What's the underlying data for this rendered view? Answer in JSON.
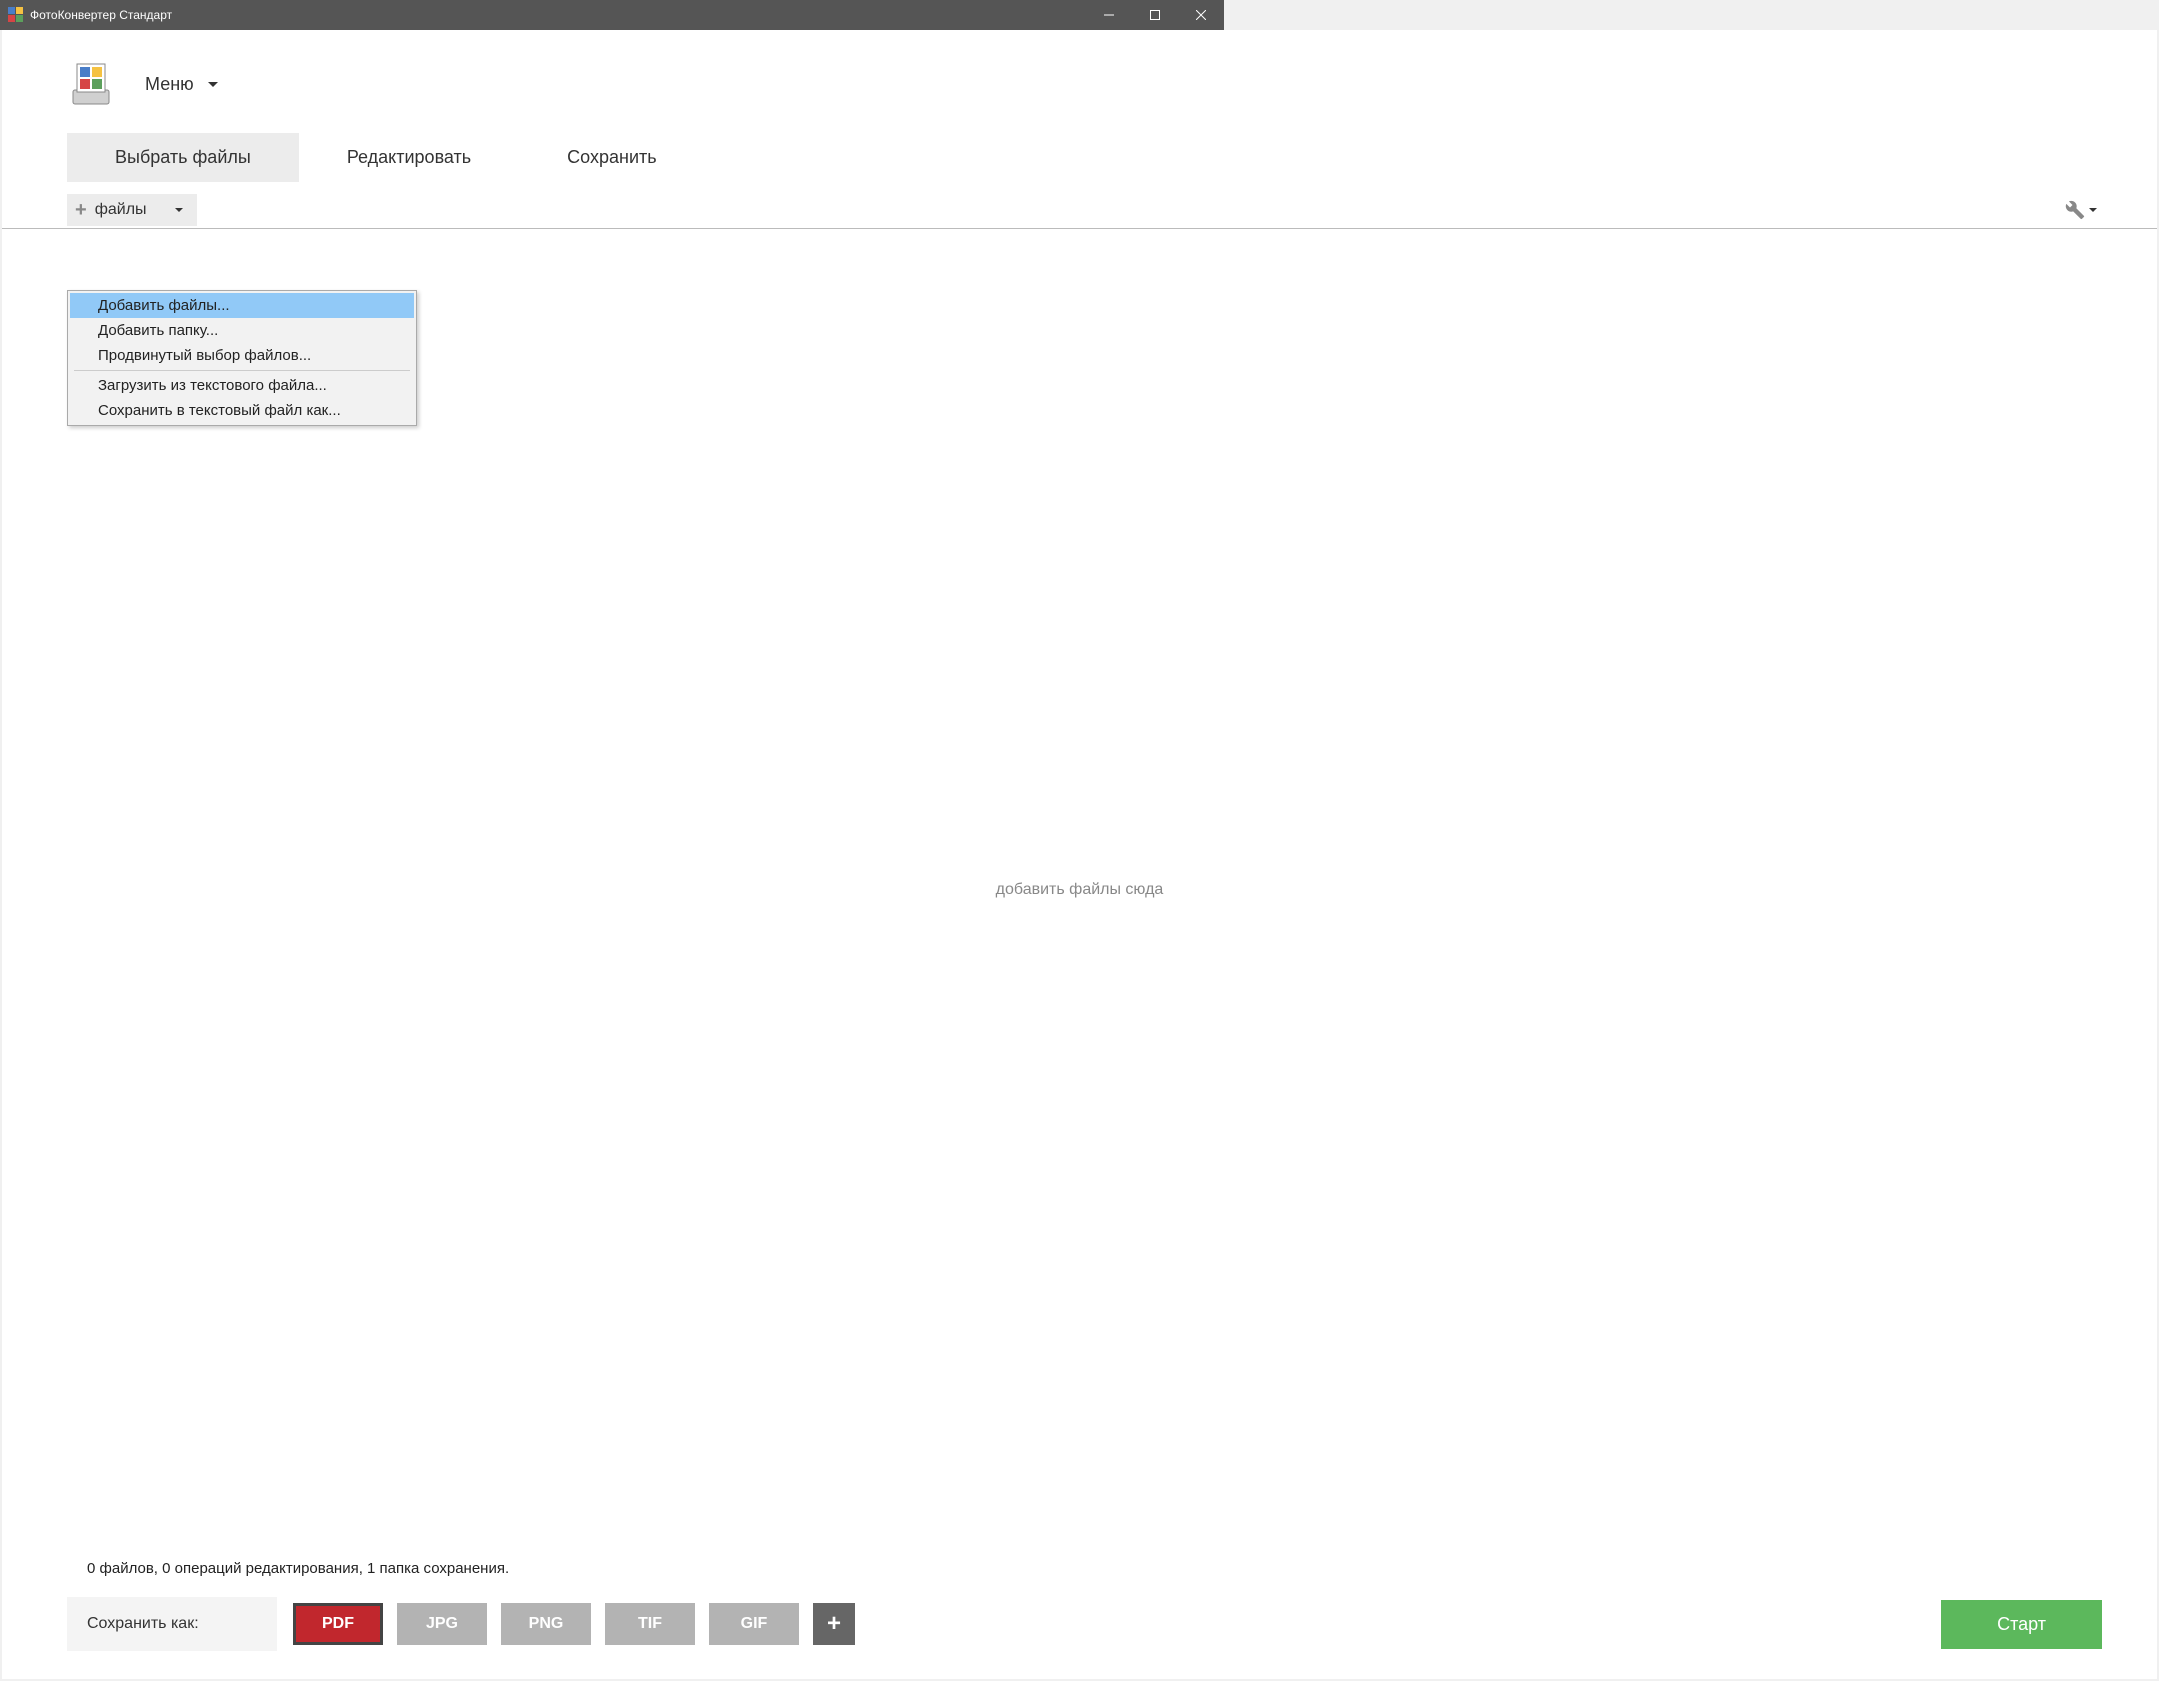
{
  "titlebar": {
    "title": "ФотоКонвертер Стандарт"
  },
  "header": {
    "menu_label": "Меню"
  },
  "tabs": {
    "select": "Выбрать файлы",
    "edit": "Редактировать",
    "save": "Сохранить"
  },
  "toolbar": {
    "files_label": "файлы"
  },
  "dropdown": {
    "add_files": "Добавить файлы...",
    "add_folder": "Добавить папку...",
    "advanced": "Продвинутый выбор файлов...",
    "load_txt": "Загрузить из текстового файла...",
    "save_txt": "Сохранить в текстовый файл как..."
  },
  "drop_area": {
    "hint": "добавить файлы сюда"
  },
  "status": {
    "text": "0 файлов, 0 операций редактирования, 1 папка сохранения."
  },
  "bottom": {
    "save_as": "Сохранить как:",
    "formats": {
      "pdf": "PDF",
      "jpg": "JPG",
      "png": "PNG",
      "tif": "TIF",
      "gif": "GIF"
    },
    "start": "Старт"
  }
}
